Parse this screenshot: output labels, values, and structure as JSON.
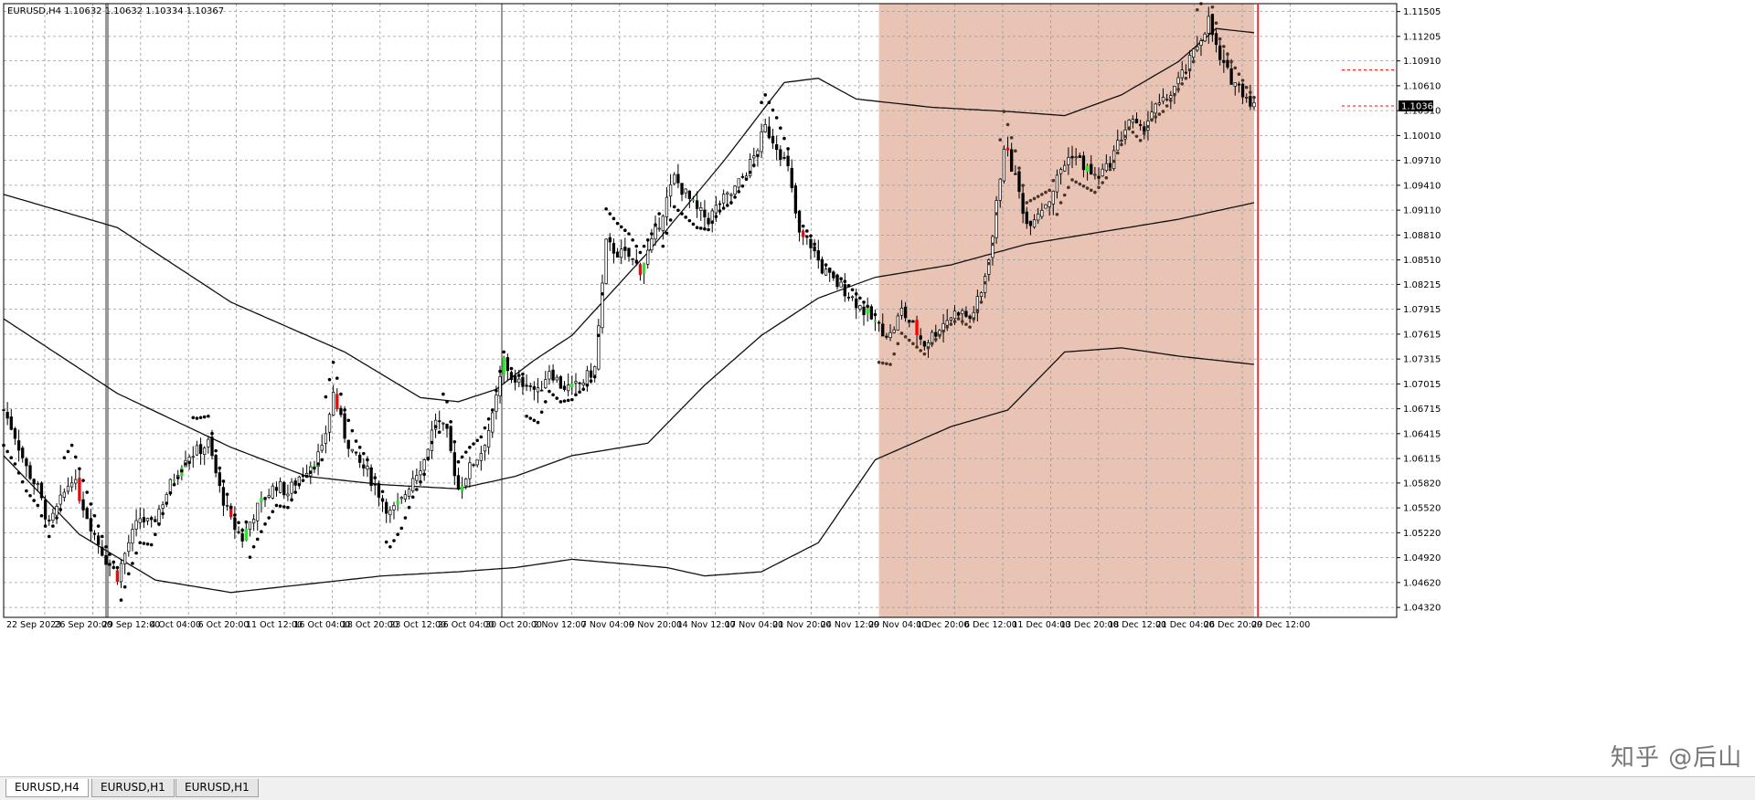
{
  "window": {
    "symbol_header": "EURUSD,H4  1.10632 1.10632 1.10334 1.10367"
  },
  "tabs": [
    {
      "label": "EURUSD,H4",
      "active": true
    },
    {
      "label": "EURUSD,H1",
      "active": false
    },
    {
      "label": "EURUSD,H1",
      "active": false
    }
  ],
  "watermark": "知乎 @后山",
  "colors": {
    "background": "#ffffff",
    "highlight_zone": "#e9c3b3",
    "grid": "#9a9a9a",
    "candle": "#000000",
    "bear_mark": "#ff0000",
    "bull_mark": "#33dd33",
    "accent_cyan": "#33cccc",
    "sar_dot": "#000000",
    "sar_dot_zone": "#4a3326",
    "price_line": "#ff0000"
  },
  "chart_data": {
    "type": "candlestick",
    "title": "",
    "symbol": "EURUSD",
    "timeframe": "H4",
    "ylim": [
      1.042,
      1.116
    ],
    "current_price": "1.10367",
    "y_ticks": [
      "1.11505",
      "1.11205",
      "1.10910",
      "1.10610",
      "1.10310",
      "1.10010",
      "1.09710",
      "1.09410",
      "1.09110",
      "1.08810",
      "1.08510",
      "1.08215",
      "1.07915",
      "1.07615",
      "1.07315",
      "1.07015",
      "1.06715",
      "1.06415",
      "1.06115",
      "1.05820",
      "1.05520",
      "1.05220",
      "1.04920",
      "1.04620",
      "1.04320"
    ],
    "y_tick_values": [
      1.11505,
      1.11205,
      1.1091,
      1.1061,
      1.1031,
      1.1001,
      1.0971,
      1.0941,
      1.0911,
      1.0881,
      1.0851,
      1.08215,
      1.07915,
      1.07615,
      1.07315,
      1.07015,
      1.06715,
      1.06415,
      1.06115,
      1.0582,
      1.0552,
      1.0522,
      1.0492,
      1.0462,
      1.0432
    ],
    "x_ticks": [
      "22 Sep 2023",
      "26 Sep 20:00",
      "29 Sep 12:00",
      "4 Oct 04:00",
      "6 Oct 20:00",
      "11 Oct 12:00",
      "16 Oct 04:00",
      "18 Oct 20:00",
      "23 Oct 12:00",
      "26 Oct 04:00",
      "30 Oct 20:00",
      "2 Nov 12:00",
      "7 Nov 04:00",
      "9 Nov 20:00",
      "14 Nov 12:00",
      "17 Nov 04:00",
      "21 Nov 20:00",
      "24 Nov 12:00",
      "29 Nov 04:00",
      "1 Dec 20:00",
      "6 Dec 12:00",
      "11 Dec 04:00",
      "13 Dec 20:00",
      "18 Dec 12:00",
      "21 Dec 04:00",
      "26 Dec 20:00",
      "29 Dec 12:00"
    ],
    "close_path": [
      [
        0,
        1.067
      ],
      [
        3,
        1.064
      ],
      [
        6,
        1.06
      ],
      [
        9,
        1.0575
      ],
      [
        12,
        1.053
      ],
      [
        15,
        1.056
      ],
      [
        18,
        1.059
      ],
      [
        21,
        1.0555
      ],
      [
        24,
        1.052
      ],
      [
        27,
        1.049
      ],
      [
        30,
        1.047
      ],
      [
        33,
        1.051
      ],
      [
        36,
        1.054
      ],
      [
        39,
        1.053
      ],
      [
        42,
        1.056
      ],
      [
        45,
        1.059
      ],
      [
        48,
        1.0615
      ],
      [
        51,
        1.062
      ],
      [
        54,
        1.063
      ],
      [
        57,
        1.0575
      ],
      [
        60,
        1.0535
      ],
      [
        63,
        1.0515
      ],
      [
        66,
        1.0545
      ],
      [
        69,
        1.0565
      ],
      [
        72,
        1.058
      ],
      [
        75,
        1.057
      ],
      [
        78,
        1.059
      ],
      [
        81,
        1.0605
      ],
      [
        84,
        1.062
      ],
      [
        87,
        1.069
      ],
      [
        90,
        1.064
      ],
      [
        93,
        1.061
      ],
      [
        96,
        1.0595
      ],
      [
        99,
        1.057
      ],
      [
        102,
        1.0545
      ],
      [
        105,
        1.056
      ],
      [
        108,
        1.059
      ],
      [
        111,
        1.061
      ],
      [
        114,
        1.066
      ],
      [
        117,
        1.064
      ],
      [
        120,
        1.0575
      ],
      [
        123,
        1.06
      ],
      [
        126,
        1.062
      ],
      [
        129,
        1.066
      ],
      [
        132,
        1.073
      ],
      [
        135,
        1.07
      ],
      [
        138,
        1.0705
      ],
      [
        141,
        1.069
      ],
      [
        144,
        1.072
      ],
      [
        147,
        1.07
      ],
      [
        150,
        1.0695
      ],
      [
        153,
        1.0705
      ],
      [
        156,
        1.072
      ],
      [
        159,
        1.087
      ],
      [
        162,
        1.086
      ],
      [
        165,
        1.0855
      ],
      [
        168,
        1.084
      ],
      [
        171,
        1.087
      ],
      [
        174,
        1.091
      ],
      [
        177,
        1.095
      ],
      [
        180,
        1.093
      ],
      [
        183,
        1.091
      ],
      [
        186,
        1.09
      ],
      [
        189,
        1.092
      ],
      [
        192,
        1.093
      ],
      [
        195,
        1.095
      ],
      [
        198,
        1.0975
      ],
      [
        201,
        1.101
      ],
      [
        204,
        1.099
      ],
      [
        207,
        1.096
      ],
      [
        210,
        1.088
      ],
      [
        213,
        1.087
      ],
      [
        216,
        1.084
      ],
      [
        219,
        1.0825
      ],
      [
        222,
        1.0815
      ],
      [
        225,
        1.08
      ],
      [
        228,
        1.0785
      ],
      [
        231,
        1.077
      ],
      [
        234,
        1.076
      ],
      [
        237,
        1.079
      ],
      [
        240,
        1.077
      ],
      [
        243,
        1.075
      ],
      [
        246,
        1.0765
      ],
      [
        249,
        1.078
      ],
      [
        252,
        1.079
      ],
      [
        255,
        1.078
      ],
      [
        258,
        1.081
      ],
      [
        261,
        1.088
      ],
      [
        264,
        1.099
      ],
      [
        267,
        1.095
      ],
      [
        270,
        1.0895
      ],
      [
        273,
        1.091
      ],
      [
        276,
        1.0925
      ],
      [
        279,
        1.096
      ],
      [
        282,
        1.098
      ],
      [
        285,
        1.0965
      ],
      [
        288,
        1.095
      ],
      [
        291,
        1.096
      ],
      [
        294,
        1.099
      ],
      [
        297,
        1.102
      ],
      [
        300,
        1.1005
      ],
      [
        303,
        1.103
      ],
      [
        306,
        1.104
      ],
      [
        309,
        1.106
      ],
      [
        312,
        1.108
      ],
      [
        315,
        1.111
      ],
      [
        318,
        1.114
      ],
      [
        321,
        1.109
      ],
      [
        324,
        1.107
      ],
      [
        327,
        1.1055
      ],
      [
        330,
        1.1037
      ]
    ],
    "bollinger_upper": [
      [
        0,
        1.093
      ],
      [
        30,
        1.089
      ],
      [
        60,
        1.08
      ],
      [
        90,
        1.074
      ],
      [
        110,
        1.0685
      ],
      [
        120,
        1.068
      ],
      [
        130,
        1.0695
      ],
      [
        140,
        1.073
      ],
      [
        150,
        1.076
      ],
      [
        170,
        1.086
      ],
      [
        190,
        1.097
      ],
      [
        206,
        1.1065
      ],
      [
        215,
        1.107
      ],
      [
        225,
        1.1045
      ],
      [
        245,
        1.1035
      ],
      [
        265,
        1.103
      ],
      [
        280,
        1.1025
      ],
      [
        295,
        1.105
      ],
      [
        310,
        1.109
      ],
      [
        320,
        1.113
      ],
      [
        330,
        1.1125
      ]
    ],
    "bollinger_middle": [
      [
        0,
        1.078
      ],
      [
        30,
        1.069
      ],
      [
        60,
        1.0625
      ],
      [
        80,
        1.059
      ],
      [
        100,
        1.058
      ],
      [
        120,
        1.0575
      ],
      [
        135,
        1.059
      ],
      [
        150,
        1.0615
      ],
      [
        170,
        1.063
      ],
      [
        185,
        1.07
      ],
      [
        200,
        1.076
      ],
      [
        215,
        1.0805
      ],
      [
        230,
        1.083
      ],
      [
        250,
        1.0845
      ],
      [
        270,
        1.087
      ],
      [
        290,
        1.0885
      ],
      [
        310,
        1.09
      ],
      [
        330,
        1.092
      ]
    ],
    "bollinger_lower": [
      [
        0,
        1.0615
      ],
      [
        20,
        1.052
      ],
      [
        40,
        1.0465
      ],
      [
        60,
        1.045
      ],
      [
        80,
        1.046
      ],
      [
        100,
        1.047
      ],
      [
        120,
        1.0475
      ],
      [
        135,
        1.048
      ],
      [
        150,
        1.049
      ],
      [
        175,
        1.048
      ],
      [
        185,
        1.047
      ],
      [
        200,
        1.0475
      ],
      [
        215,
        1.051
      ],
      [
        230,
        1.061
      ],
      [
        250,
        1.065
      ],
      [
        265,
        1.067
      ],
      [
        280,
        1.074
      ],
      [
        295,
        1.0745
      ],
      [
        310,
        1.0735
      ],
      [
        330,
        1.0725
      ]
    ],
    "bars_total": 331,
    "highlight_start_bar": 231,
    "cursor_line_bar": 331
  }
}
